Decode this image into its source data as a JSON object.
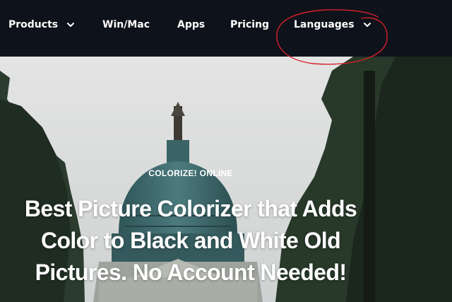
{
  "nav": {
    "products": "Products",
    "winmac": "Win/Mac",
    "apps": "Apps",
    "pricing": "Pricing",
    "languages": "Languages"
  },
  "hero": {
    "eyebrow": "COLORIZE! ONLINE",
    "title_line1": "Best Picture Colorizer that Adds",
    "title_line2": "Color to Black and White Old",
    "title_line3": "Pictures. No Account Needed!"
  },
  "colors": {
    "nav_bg": "#0e121a",
    "nav_text": "#ffffff",
    "annotation": "#d8202a",
    "sky": "#dcdcdc",
    "dome": "#3d6a6e"
  }
}
